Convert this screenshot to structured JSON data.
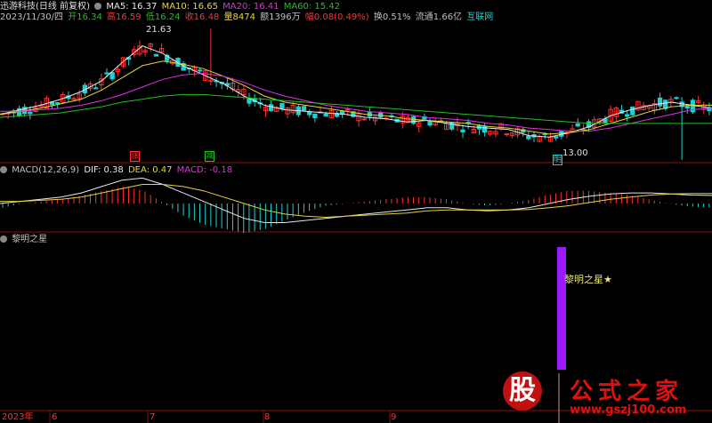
{
  "header": {
    "stock": "迅游科技(日线 前复权)",
    "ma5": "MA5: 16.37",
    "ma10": "MA10: 16.65",
    "ma20": "MA20: 16.41",
    "ma60": "MA60: 15.42",
    "date": "2023/11/30/四",
    "open": "开16.34",
    "high": "高16.59",
    "low": "低16.24",
    "close": "收16.48",
    "vol": "量8474",
    "amount": "额1396万",
    "range": "幅0.08(0.49%)",
    "turnover": "换0.51%",
    "float": "流通1.66亿",
    "industry": "互联网"
  },
  "macd_header": {
    "name": "MACD(12,26,9)",
    "dif": "DIF: 0.38",
    "dea": "DEA: 0.47",
    "macd": "MACD: -0.18"
  },
  "indicator": {
    "name": "黎明之星",
    "signal_label": "黎明之星★"
  },
  "price_panel": {
    "high_label": "21.63",
    "low_label": "13.00",
    "rise_tag": "涨",
    "fall_tag": "减",
    "marker_tag": "明"
  },
  "x_axis": {
    "labels": [
      "2023年",
      "6",
      "7",
      "8",
      "9"
    ]
  },
  "watermark": {
    "logo": "股",
    "title": "公式之家",
    "url": "www.gszj100.com"
  },
  "colors": {
    "up": "#ff3030",
    "down": "#20d0d0",
    "ma5": "#e8e8e8",
    "ma10": "#e8d23a",
    "ma20": "#e030e0",
    "ma60": "#20c020",
    "signal": "#9a1aff",
    "grid": "#8a1010"
  },
  "chart_data": {
    "type": "candlestick",
    "ylim": [
      13,
      22
    ],
    "high_max": 21.63,
    "low_min": 13.0,
    "ma_series": [
      {
        "name": "MA5",
        "values": [
          16.0,
          16.3,
          16.6,
          17.0,
          17.5,
          18.2,
          19.4,
          20.5,
          20.0,
          19.2,
          18.6,
          18.0,
          17.2,
          16.6,
          16.3,
          16.2,
          16.1,
          16.0,
          15.8,
          15.7,
          15.5,
          15.6,
          15.4,
          15.2,
          15.1,
          15.0,
          14.6,
          14.5,
          14.8,
          15.2,
          15.9,
          16.3,
          16.6,
          16.8,
          16.6,
          16.4
        ]
      },
      {
        "name": "MA10",
        "values": [
          16.0,
          16.2,
          16.4,
          16.7,
          17.0,
          17.6,
          18.4,
          19.2,
          19.5,
          19.3,
          19.0,
          18.5,
          17.9,
          17.2,
          16.8,
          16.6,
          16.4,
          16.2,
          16.0,
          15.9,
          15.7,
          15.6,
          15.5,
          15.4,
          15.2,
          15.1,
          14.9,
          14.7,
          14.8,
          15.0,
          15.4,
          15.8,
          16.2,
          16.5,
          16.6,
          16.6
        ]
      },
      {
        "name": "MA20",
        "values": [
          16.2,
          16.2,
          16.3,
          16.4,
          16.6,
          16.9,
          17.3,
          17.8,
          18.3,
          18.6,
          18.7,
          18.5,
          18.1,
          17.6,
          17.2,
          16.9,
          16.6,
          16.4,
          16.2,
          16.1,
          16.0,
          15.8,
          15.7,
          15.6,
          15.4,
          15.3,
          15.1,
          15.0,
          14.9,
          14.9,
          15.1,
          15.4,
          15.7,
          16.0,
          16.3,
          16.4
        ]
      },
      {
        "name": "MA60",
        "values": [
          15.8,
          15.9,
          16.0,
          16.1,
          16.3,
          16.5,
          16.8,
          17.0,
          17.2,
          17.3,
          17.3,
          17.2,
          17.1,
          17.0,
          16.9,
          16.8,
          16.7,
          16.6,
          16.5,
          16.4,
          16.3,
          16.2,
          16.1,
          16.0,
          15.9,
          15.8,
          15.7,
          15.6,
          15.5,
          15.4,
          15.4,
          15.4,
          15.4,
          15.4,
          15.4,
          15.4
        ]
      }
    ],
    "macd": {
      "dif": [
        0.0,
        0.1,
        0.2,
        0.3,
        0.5,
        0.8,
        1.1,
        1.2,
        0.9,
        0.5,
        0.1,
        -0.3,
        -0.7,
        -0.9,
        -0.9,
        -0.8,
        -0.7,
        -0.6,
        -0.5,
        -0.4,
        -0.3,
        -0.2,
        -0.2,
        -0.3,
        -0.35,
        -0.3,
        -0.2,
        0.0,
        0.2,
        0.35,
        0.45,
        0.5,
        0.5,
        0.45,
        0.4,
        0.38
      ],
      "dea": [
        0.1,
        0.1,
        0.15,
        0.2,
        0.3,
        0.5,
        0.7,
        0.9,
        0.9,
        0.8,
        0.6,
        0.3,
        0.0,
        -0.3,
        -0.5,
        -0.6,
        -0.65,
        -0.6,
        -0.55,
        -0.5,
        -0.45,
        -0.35,
        -0.3,
        -0.3,
        -0.3,
        -0.3,
        -0.28,
        -0.2,
        -0.1,
        0.05,
        0.2,
        0.3,
        0.4,
        0.45,
        0.47,
        0.47
      ]
    },
    "signal": {
      "name": "黎明之星",
      "bar_index": 29
    }
  }
}
